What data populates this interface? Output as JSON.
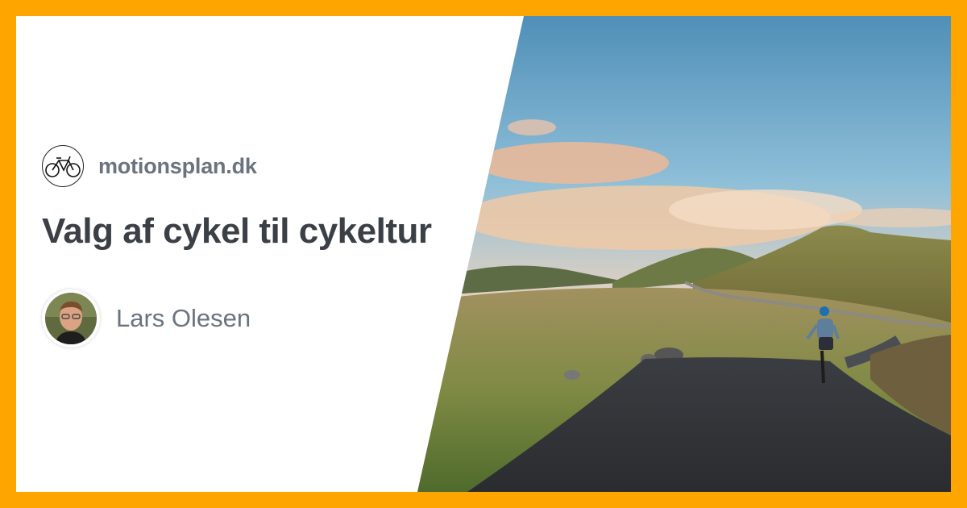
{
  "site": {
    "name": "motionsplan.dk",
    "logo_icon": "bicycle-icon"
  },
  "article": {
    "title": "Valg af cykel til cykeltur"
  },
  "author": {
    "name": "Lars Olesen",
    "avatar_icon": "person-avatar"
  },
  "colors": {
    "frame": "#FFA500",
    "card": "#FFFFFF",
    "title_text": "#3B3F46",
    "muted_text": "#6B7280"
  },
  "image": {
    "subject": "cyclist-on-mountain-road-photo"
  }
}
